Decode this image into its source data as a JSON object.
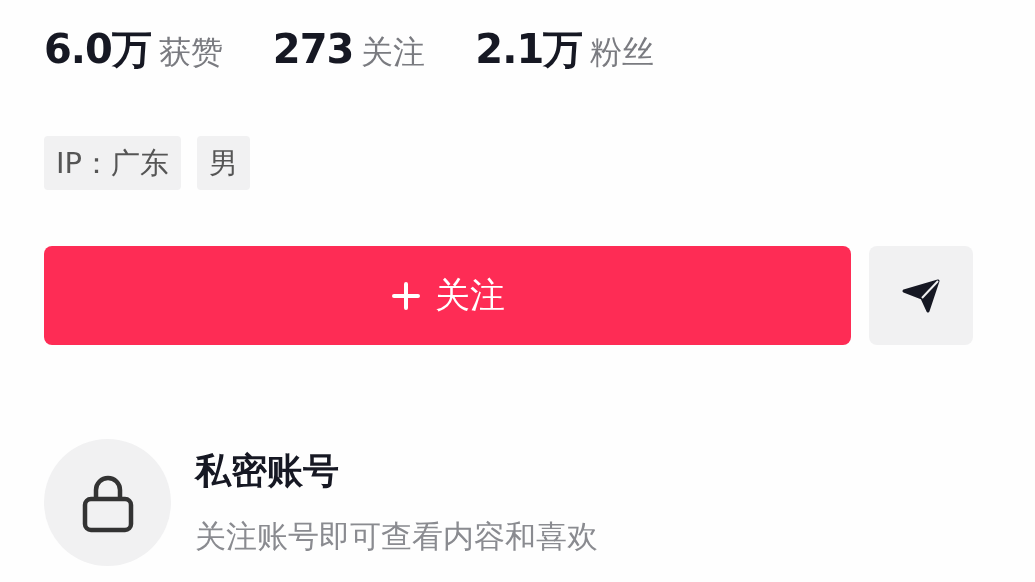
{
  "stats": [
    {
      "number": "6.0万",
      "caption": "获赞"
    },
    {
      "number": "273",
      "caption": "关注"
    },
    {
      "number": "2.1万",
      "caption": "粉丝"
    }
  ],
  "tags": [
    "IP：广东",
    "男"
  ],
  "follow_button": {
    "label": "关注"
  },
  "private_notice": {
    "title": "私密账号",
    "subtitle": "关注账号即可查看内容和喜欢"
  }
}
